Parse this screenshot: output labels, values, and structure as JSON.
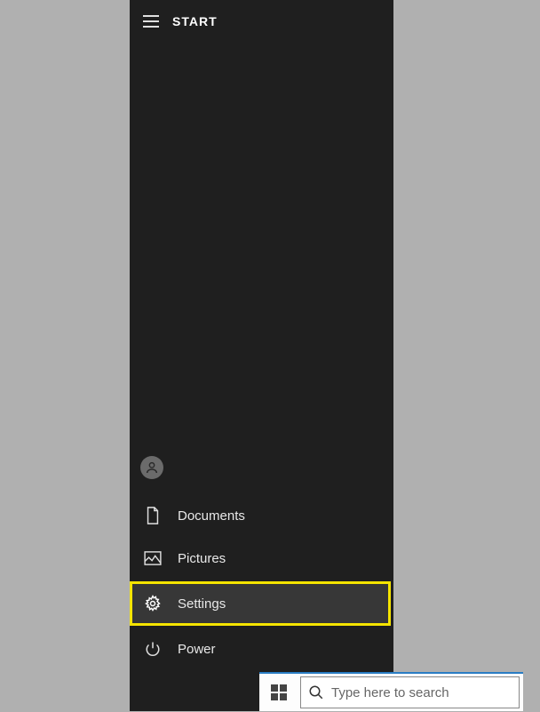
{
  "header": {
    "title": "START"
  },
  "menu": {
    "documents": "Documents",
    "pictures": "Pictures",
    "settings": "Settings",
    "power": "Power"
  },
  "search": {
    "placeholder": "Type here to search"
  }
}
